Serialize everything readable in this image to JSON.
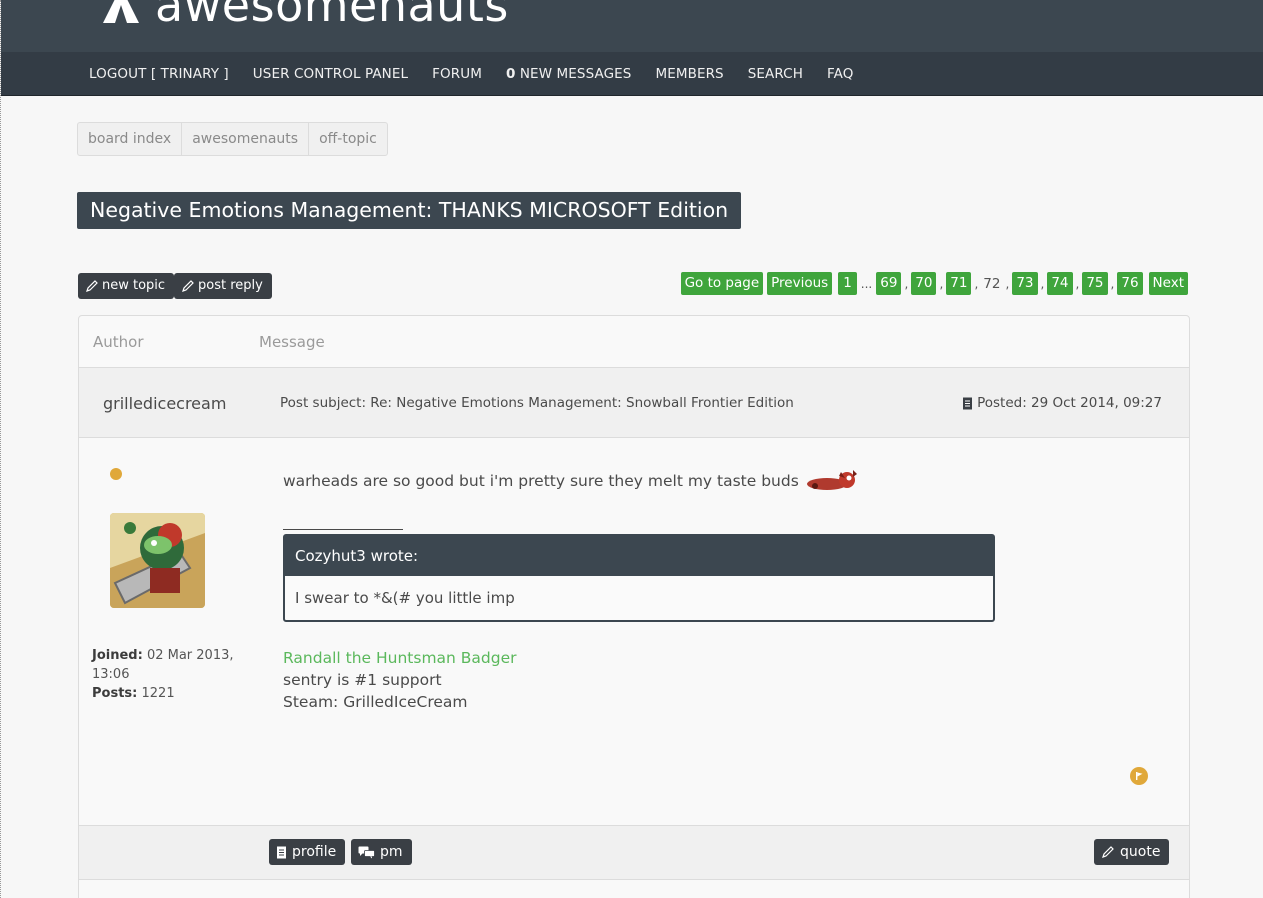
{
  "site": {
    "logo_text": "awesomenauts"
  },
  "nav": {
    "logout": "LOGOUT [ TRINARY ]",
    "ucp": "USER CONTROL PANEL",
    "forum": "FORUM",
    "new_messages_count": "0",
    "new_messages_label": "NEW MESSAGES",
    "members": "MEMBERS",
    "search": "SEARCH",
    "faq": "FAQ"
  },
  "breadcrumb": [
    "board index",
    "awesomenauts",
    "off-topic"
  ],
  "topic": {
    "title": "Negative Emotions Management: THANKS MICROSOFT Edition"
  },
  "actions": {
    "new_topic": "new topic",
    "post_reply": "post reply"
  },
  "pagination": {
    "goto": "Go to page",
    "previous": "Previous",
    "first": "1",
    "ellipsis": "...",
    "pages_before": [
      "69",
      "70",
      "71"
    ],
    "current": "72",
    "pages_after": [
      "73",
      "74",
      "75",
      "76"
    ],
    "next": "Next"
  },
  "table": {
    "col_author": "Author",
    "col_message": "Message"
  },
  "post": {
    "author": "grilledicecream",
    "subject": "Post subject: Re: Negative Emotions Management: Snowball Frontier Edition",
    "posted": "Posted: 29 Oct 2014, 09:27",
    "text": "warheads are so good but i'm pretty sure they melt my taste buds",
    "quote_author": "Cozyhut3 wrote:",
    "quote_text": "I swear to *&(# you little imp",
    "joined_label": "Joined:",
    "joined_value": "02 Mar 2013, 13:06",
    "posts_label": "Posts:",
    "posts_value": "1221",
    "signature": {
      "badge": "Randall the Huntsman Badger",
      "line1": "sentry is #1 support",
      "line2": "Steam: GrilledIceCream"
    }
  },
  "post_actions": {
    "profile": "profile",
    "pm": "pm",
    "quote": "quote"
  },
  "colors": {
    "header": "#3c4750",
    "nav": "#333c45",
    "page_button": "#3fa53c",
    "online": "#e0a83a",
    "badge_link": "#5bb85c"
  }
}
